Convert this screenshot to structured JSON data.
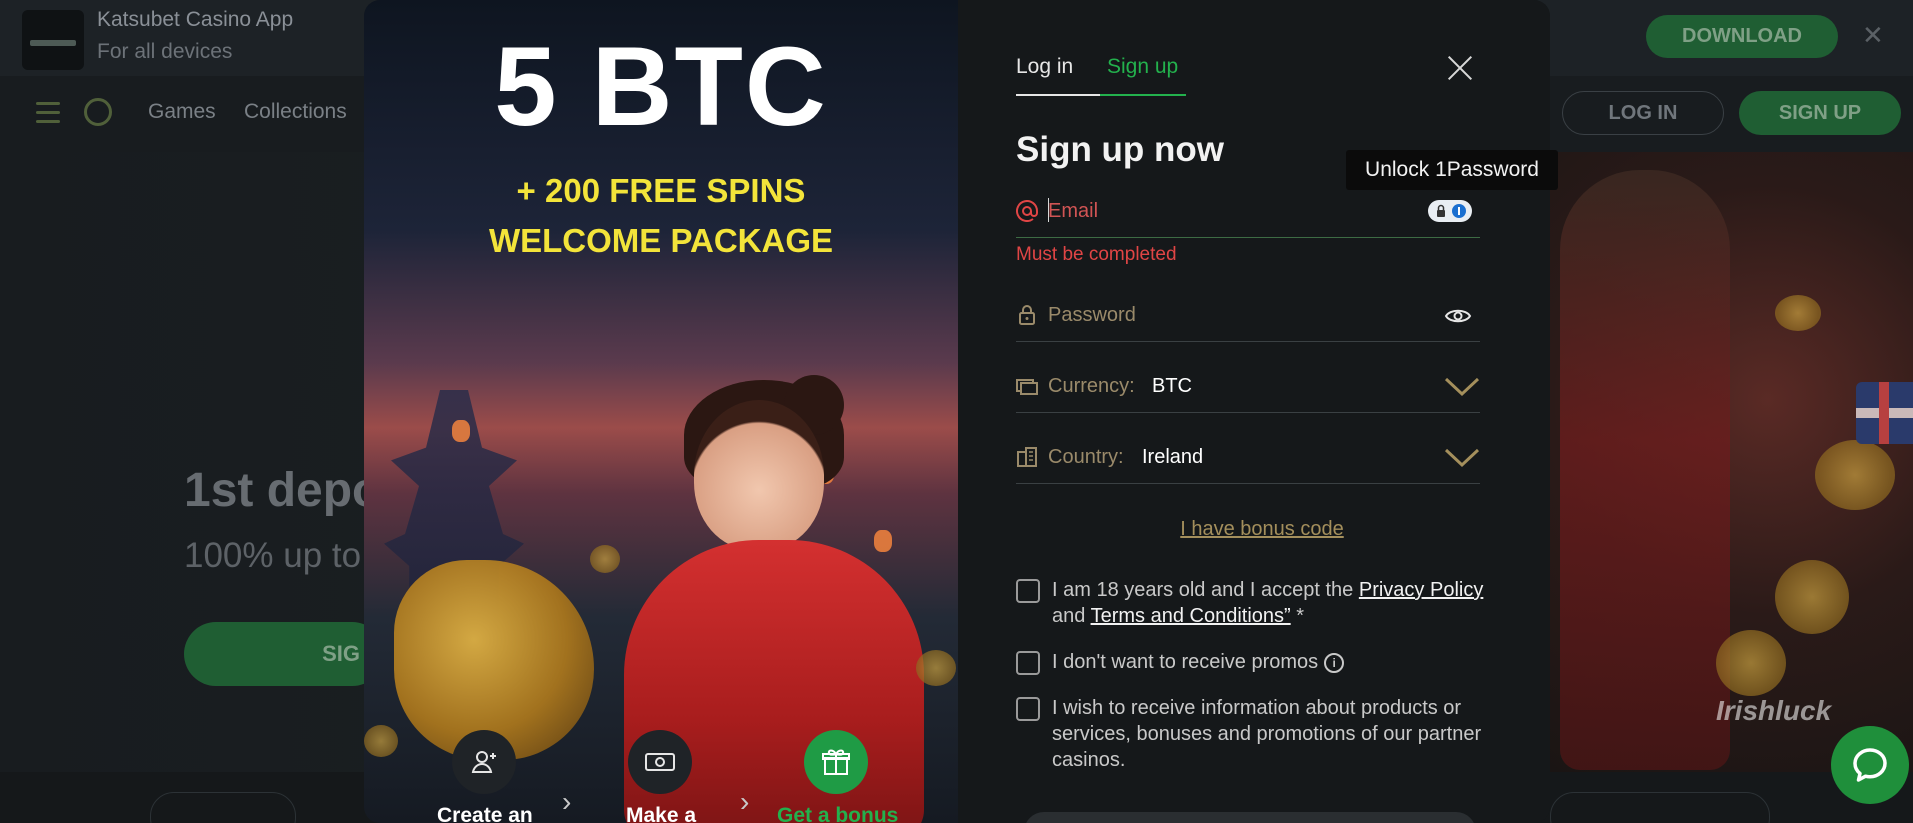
{
  "app_banner": {
    "title": "Katsubet Casino App",
    "subtitle": "For all devices",
    "download_label": "DOWNLOAD",
    "close_symbol": "✕"
  },
  "nav": {
    "links": [
      "Games",
      "Collections"
    ],
    "login_label": "LOG IN",
    "signup_label": "SIGN UP"
  },
  "hero": {
    "title": "1st depo",
    "subtitle": "100% up to",
    "button_label": "SIG"
  },
  "promo": {
    "amount": "5 BTC",
    "line1": "+ 200 FREE SPINS",
    "line2": "WELCOME PACKAGE",
    "steps": [
      {
        "label": "Create an",
        "icon": "user-add-icon"
      },
      {
        "label": "Make a",
        "icon": "cash-icon"
      },
      {
        "label": "Get a bonus",
        "icon": "gift-icon"
      }
    ]
  },
  "form": {
    "tabs": {
      "login": "Log in",
      "signup": "Sign up"
    },
    "heading": "Sign up now",
    "email": {
      "placeholder": "Email",
      "icon": "at-icon"
    },
    "email_error": "Must be completed",
    "password": {
      "placeholder": "Password",
      "icon": "lock-icon"
    },
    "currency": {
      "label": "Currency:",
      "value": "BTC"
    },
    "country": {
      "label": "Country:",
      "value": "Ireland"
    },
    "bonus_link": "I have bonus code",
    "checkbox_terms": {
      "prefix": "I am 18 years old and I accept the ",
      "privacy_link": "Privacy Policy",
      "and": " and ",
      "terms_link": "Terms and Conditions”",
      "suffix": " *"
    },
    "checkbox_promos": "I don't want to receive promos",
    "checkbox_partners": "I wish to receive information about products or services, bonuses and promotions of our partner casinos."
  },
  "tooltip": "Unlock 1Password",
  "watermark": "Irishluck",
  "colors": {
    "accent_green": "#23b14d",
    "error_red": "#e04545",
    "promo_yellow": "#f3e43a"
  }
}
